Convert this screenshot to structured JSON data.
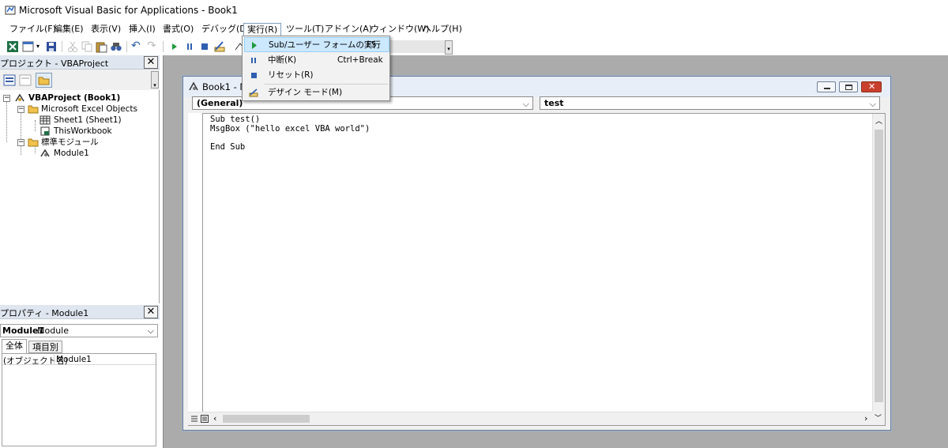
{
  "app": {
    "title": "Microsoft Visual Basic for Applications - Book1"
  },
  "menubar": {
    "items": [
      {
        "label": "ファイル(F)"
      },
      {
        "label": "編集(E)"
      },
      {
        "label": "表示(V)"
      },
      {
        "label": "挿入(I)"
      },
      {
        "label": "書式(O)"
      },
      {
        "label": "デバッグ(D)"
      },
      {
        "label": "実行(R)",
        "active": true
      },
      {
        "label": "ツール(T)"
      },
      {
        "label": "アドイン(A)"
      },
      {
        "label": "ウィンドウ(W)"
      },
      {
        "label": "ヘルプ(H)"
      }
    ]
  },
  "run_menu": {
    "items": [
      {
        "label": "Sub/ユーザー フォームの実行",
        "shortcut": "F5",
        "icon": "run-icon",
        "highlighted": true
      },
      {
        "label": "中断(K)",
        "shortcut": "Ctrl+Break",
        "icon": "pause-icon"
      },
      {
        "label": "リセット(R)",
        "shortcut": "",
        "icon": "stop-icon"
      },
      {
        "label": "デザイン モード(M)",
        "shortcut": "",
        "icon": "design-mode-icon"
      }
    ]
  },
  "project_panel": {
    "title": "プロジェクト - VBAProject",
    "tree": {
      "root": "VBAProject (Book1)",
      "folder1": "Microsoft Excel Objects",
      "sheet1": "Sheet1 (Sheet1)",
      "thisworkbook": "ThisWorkbook",
      "folder2": "標準モジュール",
      "module1": "Module1"
    }
  },
  "properties_panel": {
    "title": "プロパティ - Module1",
    "selector_name": "Module1",
    "selector_type": "Module",
    "tabs": [
      "全体",
      "項目別"
    ],
    "rows": [
      {
        "key": "(オブジェクト名)",
        "value": "Module1"
      }
    ]
  },
  "module_window": {
    "title": "Book1 - Mo",
    "object_dropdown": "(General)",
    "proc_dropdown": "test",
    "code_lines": [
      "Sub test()",
      "MsgBox (\"hello excel VBA world\")",
      "",
      "End Sub"
    ]
  },
  "colors": {
    "menu_highlight": "#cce8ff",
    "mdi_background": "#ababab",
    "close_button": "#c8402c"
  }
}
